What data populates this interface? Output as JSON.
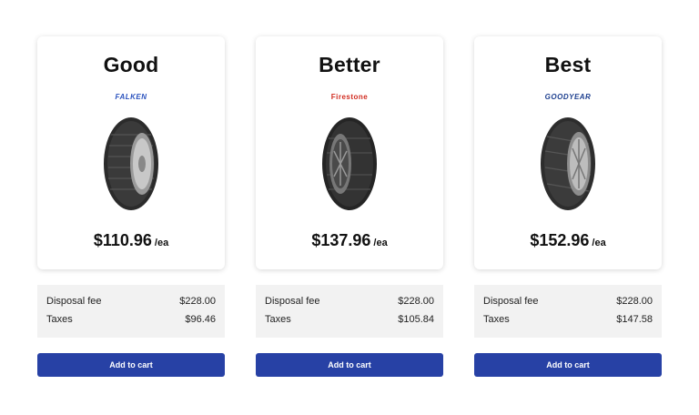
{
  "products": [
    {
      "tier": "Good",
      "brand": "FALKEN",
      "price": "$110.96",
      "unit": "/ea",
      "fees": [
        {
          "label": "Disposal fee",
          "value": "$228.00"
        },
        {
          "label": "Taxes",
          "value": "$96.46"
        }
      ],
      "button_label": "Add to cart"
    },
    {
      "tier": "Better",
      "brand": "Firestone",
      "price": "$137.96",
      "unit": "/ea",
      "fees": [
        {
          "label": "Disposal fee",
          "value": "$228.00"
        },
        {
          "label": "Taxes",
          "value": "$105.84"
        }
      ],
      "button_label": "Add to cart"
    },
    {
      "tier": "Best",
      "brand": "GOODYEAR",
      "price": "$152.96",
      "unit": "/ea",
      "fees": [
        {
          "label": "Disposal fee",
          "value": "$228.00"
        },
        {
          "label": "Taxes",
          "value": "$147.58"
        }
      ],
      "button_label": "Add to cart"
    }
  ],
  "colors": {
    "button": "#2741a5",
    "fee_panel": "#f2f2f2",
    "falken": "#2a52be",
    "firestone": "#d12a1e",
    "goodyear": "#1d3f8f"
  }
}
